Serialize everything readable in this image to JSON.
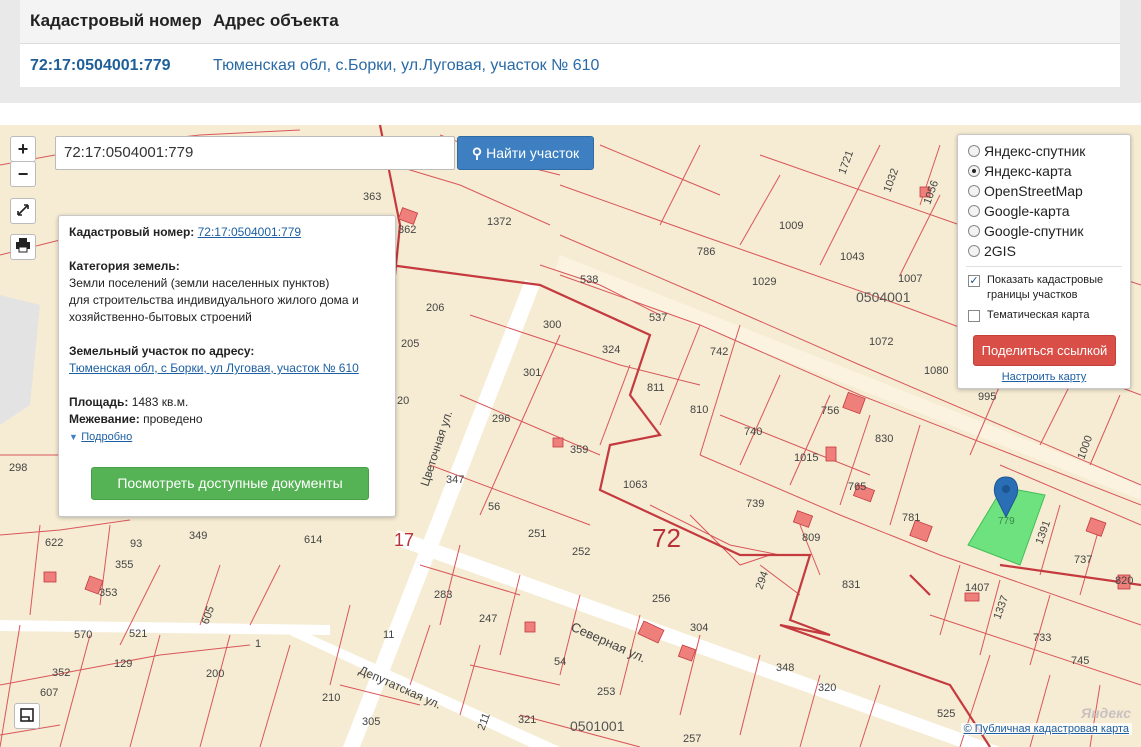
{
  "result": {
    "headers": [
      "Кадастровый номер",
      "Адрес объекта"
    ],
    "row": {
      "cadastral_number": "72:17:0504001:779",
      "address": "Тюменская обл, с.Борки, ул.Луговая, участок № 610"
    }
  },
  "map": {
    "zoom_in": "+",
    "zoom_out": "−",
    "search": {
      "value": "72:17:0504001:779",
      "button_label": "Найти участок"
    },
    "info": {
      "cad_label": "Кадастровый номер:",
      "cad_value": "72:17:0504001:779",
      "category_label": "Категория земель:",
      "category_line1": "Земли поселений (земли населенных пунктов)",
      "category_line2": "для строительства индивидуального жилого дома и",
      "category_line3": "хозяйственно-бытовых строений",
      "address_label": "Земельный участок по адресу:",
      "address_value": "Тюменская обл, с Борки, ул Луговая, участок № 610",
      "area_label": "Площадь:",
      "area_value": "1483 кв.м.",
      "survey_label": "Межевание:",
      "survey_value": "проведено",
      "more_label": "Подробно",
      "docs_button": "Посмотреть доступные документы"
    },
    "layers": {
      "options": [
        {
          "label": "Яндекс-спутник",
          "selected": false
        },
        {
          "label": "Яндекс-карта",
          "selected": true
        },
        {
          "label": "OpenStreetMap",
          "selected": false
        },
        {
          "label": "Google-карта",
          "selected": false
        },
        {
          "label": "Google-спутник",
          "selected": false
        },
        {
          "label": "2GIS",
          "selected": false
        }
      ],
      "show_borders_label": "Показать кадастровые границы участков",
      "show_borders_checked": true,
      "thematic_label": "Тематическая карта",
      "thematic_checked": false,
      "share_button": "Поделиться ссылкой",
      "configure_link": "Настроить карту"
    },
    "labels": {
      "quarter_big": "72",
      "quarter_small": "17",
      "block_a": "0504001",
      "block_b": "0501001",
      "street_1": "Цветочная ул.",
      "street_2": "Северная ул.",
      "street_3": "Депутатская ул.",
      "selected_parcel": "779"
    },
    "parcel_numbers": [
      "1721",
      "1032",
      "1056",
      "363",
      "1372",
      "362",
      "1009",
      "786",
      "1043",
      "1029",
      "1007",
      "538",
      "0504001",
      "206",
      "300",
      "537",
      "324",
      "742",
      "1072",
      "205",
      "301",
      "811",
      "1080",
      "995",
      "20",
      "296",
      "810",
      "756",
      "740",
      "830",
      "359",
      "1015",
      "1000",
      "298",
      "347",
      "1063",
      "765",
      "56",
      "739",
      "781",
      "1391",
      "622",
      "349",
      "251",
      "809",
      "614",
      "252",
      "737",
      "93",
      "355",
      "831",
      "820",
      "353",
      "283",
      "256",
      "247",
      "605",
      "1407",
      "1337",
      "570",
      "521",
      "11",
      "304",
      "294",
      "733",
      "129",
      "1",
      "54",
      "352",
      "200",
      "745",
      "607",
      "210",
      "305",
      "211",
      "253",
      "348",
      "320",
      "321",
      "257",
      "525"
    ],
    "copyright_label": "© Публичная кадастровая карта",
    "yandex_mark": "Яндекс"
  },
  "colors": {
    "map_bg": "#f6ecd3",
    "parcel_line": "#d9565a",
    "quarter_line": "#c43a3f",
    "road": "#ffffff",
    "selected_parcel": "#6ee27f",
    "marker": "#2a6fb6"
  }
}
